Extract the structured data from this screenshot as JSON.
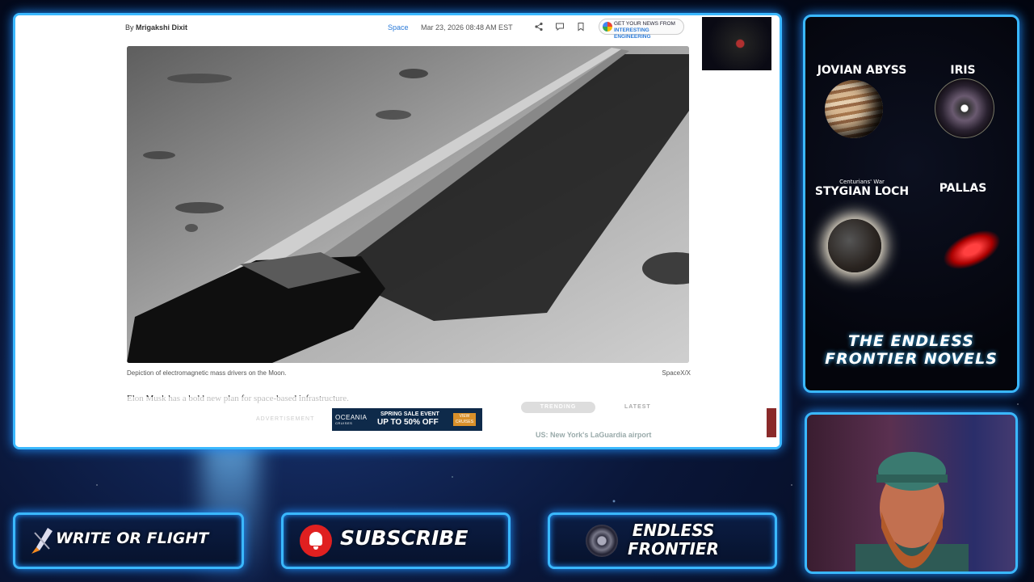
{
  "article": {
    "by_prefix": "By",
    "author": "Mrigakshi Dixit",
    "category": "Space",
    "date": "Mar 23, 2026 08:48 AM EST",
    "google_news_line1": "GET YOUR NEWS FROM",
    "google_news_line2": "INTERESTING ENGINEERING",
    "caption": "Depiction of electromagnetic mass drivers on the Moon.",
    "credit": "SpaceX/X",
    "body_start": "Elon Musk has a bold new plan for space-based infrastructure."
  },
  "sidebar": {
    "tab_trending": "TRENDING",
    "tab_latest": "LATEST",
    "headline": "US: New York's LaGuardia airport"
  },
  "ad": {
    "label": "ADVERTISEMENT",
    "brand": "OCEANIA",
    "brand_sub": "CRUISES",
    "line1": "SPRING SALE EVENT",
    "line2": "UP TO 50% OFF",
    "cta": "VIEW CRUISES"
  },
  "promo": {
    "book1": "JOVIAN ABYSS",
    "book2": "IRIS",
    "book3_sub": "Centurians' War",
    "book3": "STYGIAN LOCH",
    "book4": "PALLAS",
    "title_line1": "THE ENDLESS",
    "title_line2": "FRONTIER NOVELS"
  },
  "buttons": {
    "write_or_flight": "WRITE OR FLIGHT",
    "subscribe": "SUBSCRIBE",
    "endless_line1": "ENDLESS",
    "endless_line2": "FRONTIER"
  },
  "colors": {
    "frame_glow": "#3ab8ff",
    "subscribe_red": "#e02020",
    "link_blue": "#2a7ad8"
  },
  "icons": [
    "share-icon",
    "comment-icon",
    "bookmark-icon",
    "google-icon",
    "bell-icon",
    "rocket-icon",
    "planet-logo-icon"
  ]
}
